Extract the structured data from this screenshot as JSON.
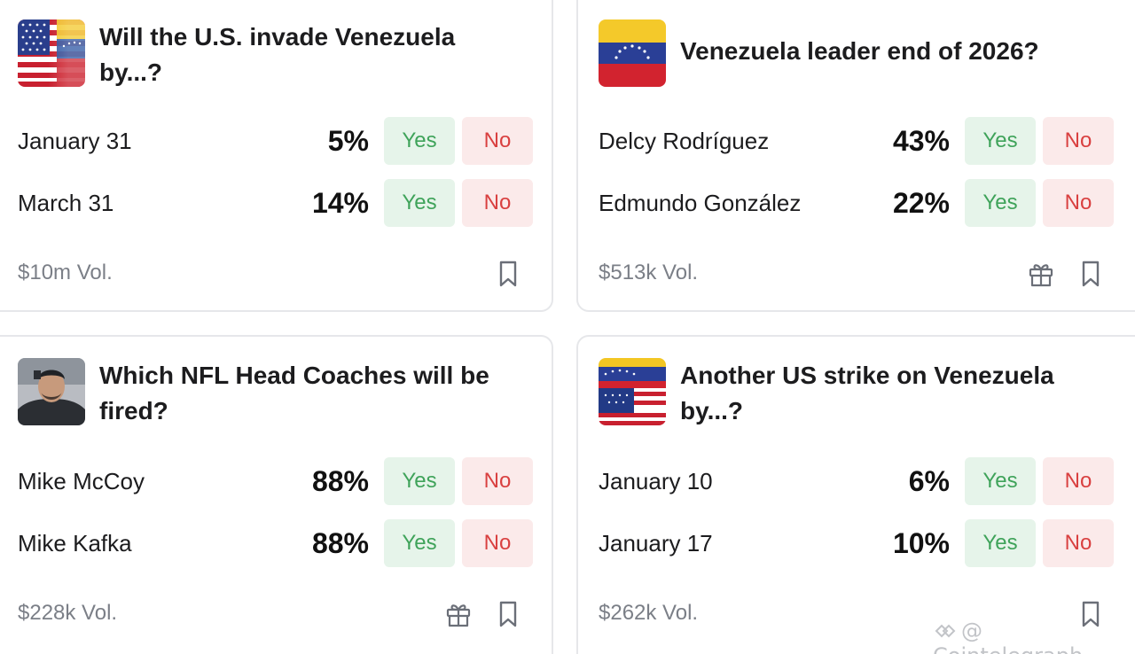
{
  "markets": [
    {
      "title": "Will the U.S. invade Venezuela by...?",
      "thumbnail": "us-venezuela-flag",
      "outcomes": [
        {
          "label": "January 31",
          "percent": "5%",
          "yes": "Yes",
          "no": "No"
        },
        {
          "label": "March 31",
          "percent": "14%",
          "yes": "Yes",
          "no": "No"
        }
      ],
      "volume": "$10m Vol.",
      "has_gift": false
    },
    {
      "title": "Venezuela leader end of 2026?",
      "thumbnail": "venezuela-flag",
      "outcomes": [
        {
          "label": "Delcy Rodríguez",
          "percent": "43%",
          "yes": "Yes",
          "no": "No"
        },
        {
          "label": "Edmundo González",
          "percent": "22%",
          "yes": "Yes",
          "no": "No"
        }
      ],
      "volume": "$513k Vol.",
      "has_gift": true
    },
    {
      "title": "Which NFL Head Coaches will be fired?",
      "thumbnail": "coach-photo",
      "outcomes": [
        {
          "label": "Mike McCoy",
          "percent": "88%",
          "yes": "Yes",
          "no": "No"
        },
        {
          "label": "Mike Kafka",
          "percent": "88%",
          "yes": "Yes",
          "no": "No"
        }
      ],
      "volume": "$228k Vol.",
      "has_gift": true
    },
    {
      "title": "Another US strike on Venezuela by...?",
      "thumbnail": "venezuela-us-flag",
      "outcomes": [
        {
          "label": "January 10",
          "percent": "6%",
          "yes": "Yes",
          "no": "No"
        },
        {
          "label": "January 17",
          "percent": "10%",
          "yes": "Yes",
          "no": "No"
        }
      ],
      "volume": "$262k Vol.",
      "has_gift": false
    }
  ],
  "watermark": "@ Cointelegraph",
  "colors": {
    "yes_bg": "#e6f4ea",
    "yes_text": "#3fa35a",
    "no_bg": "#fbeaea",
    "no_text": "#d94040",
    "muted": "#7b7f87"
  }
}
